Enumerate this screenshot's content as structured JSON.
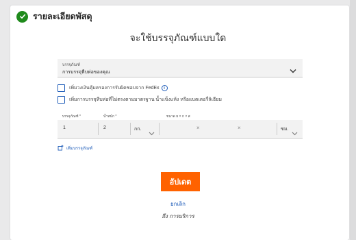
{
  "header": {
    "title": "รายละเอียดพัสดุ"
  },
  "main_title": "จะใช้บรรจุภัณฑ์แบบใด",
  "packaging": {
    "label": "บรรจุภัณฑ์",
    "value": "การบรรจุหีบห่อของคุณ"
  },
  "checkboxes": [
    {
      "label": "เพิ่มวงเงินคุ้มครองการรับผิดชอบจาก FedEx",
      "checked": false,
      "info_icon": "i"
    },
    {
      "label": "เพิ่มการบรรจุหีบห่อที่ไม่ตรงตามมาตรฐาน น้ำแข็งแห้ง หรือแบตเตอรี่ลิเธียม",
      "checked": false
    }
  ],
  "fields": {
    "packages_label": "บรรจุภัณฑ์ *",
    "packages_value": "1",
    "weight_label": "น้ำหนัก *",
    "weight_value": "2",
    "weight_unit": "กก.",
    "dimensions_label": "ขนาด ย × ก × ส",
    "dim_sep": "×",
    "dim_unit": "ซม."
  },
  "add_package_label": "เพิ่มบรรจุภัณฑ์",
  "update_button": "อัปเดต",
  "cancel_link": "ยกเลิก",
  "to_service": "ถึง การบริการ",
  "colors": {
    "accent_orange": "#ff6200",
    "link_blue": "#1b5ab8",
    "success_green": "#1f8a1c"
  }
}
